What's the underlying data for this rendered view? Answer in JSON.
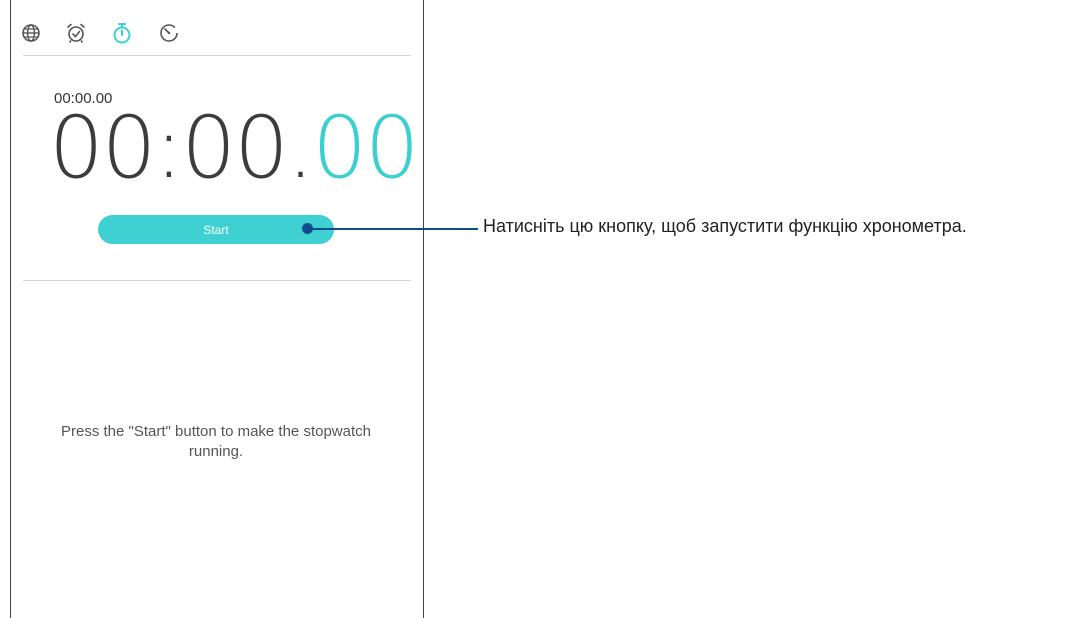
{
  "tabs": [
    {
      "icon": "globe-icon",
      "label": "World clock"
    },
    {
      "icon": "alarm-clock-icon",
      "label": "Alarm"
    },
    {
      "icon": "stopwatch-icon",
      "label": "Stopwatch",
      "active": true
    },
    {
      "icon": "timer-icon",
      "label": "Timer"
    }
  ],
  "stopwatch": {
    "lap_time": "00:00.00",
    "main_time": "00:00.",
    "main_ms": "00",
    "start_label": "Start",
    "hint": "Press the \"Start\" button to make the stopwatch running."
  },
  "callout": {
    "text": "Натисніть цю кнопку, щоб запустити функцію хронометра."
  },
  "colors": {
    "accent": "#3fd0d1",
    "callout": "#0d4d8c",
    "icon": "#555555"
  }
}
